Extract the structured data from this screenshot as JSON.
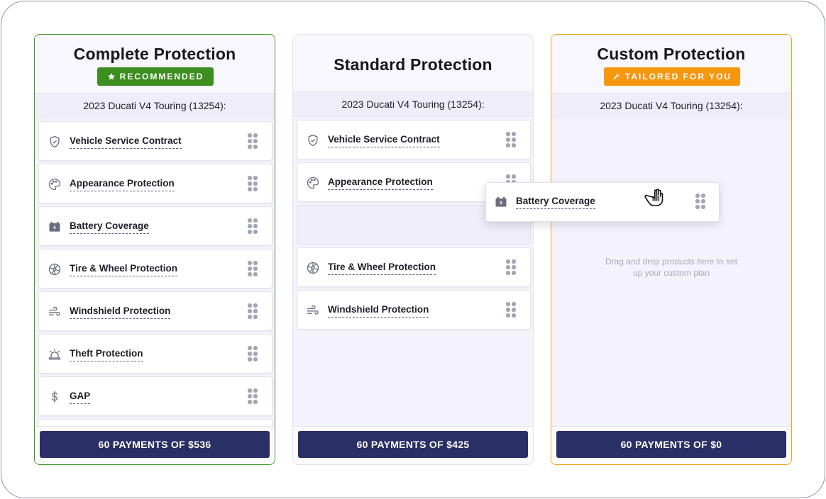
{
  "vehicle": "2023 Ducati V4 Touring (13254):",
  "plans": {
    "complete": {
      "title": "Complete Protection",
      "badge": "RECOMMENDED",
      "badge_color": "#3c8f1f",
      "items": [
        {
          "label": "Vehicle Service Contract",
          "icon": "shield-check-icon"
        },
        {
          "label": "Appearance Protection",
          "icon": "palette-icon"
        },
        {
          "label": "Battery Coverage",
          "icon": "battery-icon"
        },
        {
          "label": "Tire & Wheel Protection",
          "icon": "wheel-icon"
        },
        {
          "label": "Windshield Protection",
          "icon": "wind-icon"
        },
        {
          "label": "Theft Protection",
          "icon": "alarm-icon"
        },
        {
          "label": "GAP",
          "icon": "dollar-icon"
        }
      ],
      "payment": "60 PAYMENTS OF $536"
    },
    "standard": {
      "title": "Standard Protection",
      "items": [
        {
          "label": "Vehicle Service Contract",
          "icon": "shield-check-icon"
        },
        {
          "label": "Appearance Protection",
          "icon": "palette-icon"
        },
        {
          "label": "Tire & Wheel Protection",
          "icon": "wheel-icon"
        },
        {
          "label": "Windshield Protection",
          "icon": "wind-icon"
        }
      ],
      "payment": "60 PAYMENTS OF $425"
    },
    "custom": {
      "title": "Custom Protection",
      "badge": "TAILORED FOR YOU",
      "badge_color": "#f7960f",
      "empty_text": "Drag and drop products here to set up your custom plan",
      "payment": "60 PAYMENTS OF $0"
    }
  },
  "dragging_item": {
    "label": "Battery Coverage",
    "icon": "battery-icon"
  },
  "colors": {
    "primary_button": "#2a2f66",
    "complete_border": "#3f9a28",
    "custom_border": "#f4a21b"
  }
}
